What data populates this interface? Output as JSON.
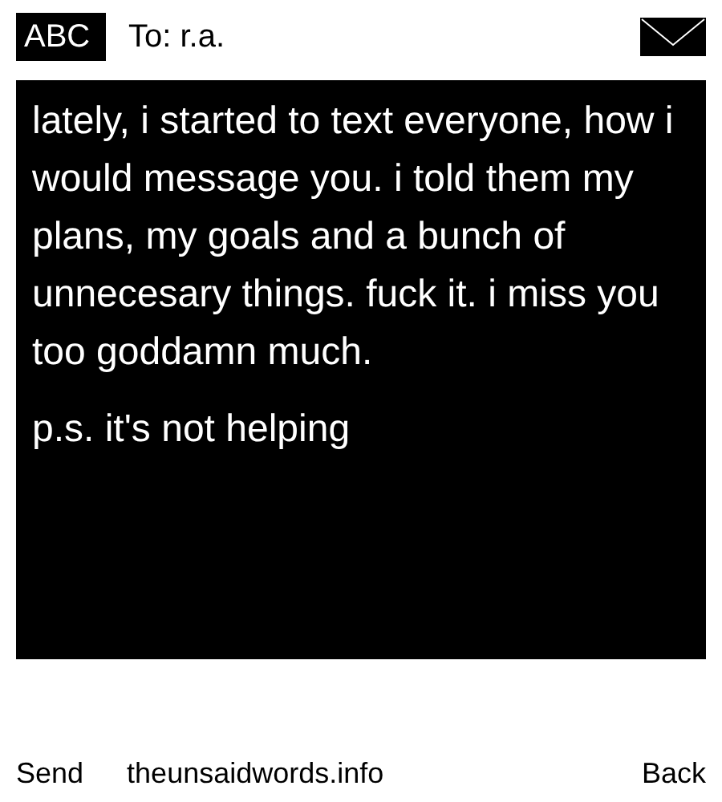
{
  "header": {
    "mode": "ABC",
    "recipient": "To: r.a."
  },
  "message": {
    "paragraphs": [
      "lately, i started to text everyone, how i would message you. i told them my plans, my goals and a bunch of unnecesary things. fuck it. i miss you too goddamn much.",
      "p.s. it's not helping"
    ]
  },
  "footer": {
    "left": "Send",
    "site": "theunsaidwords.info",
    "right": "Back"
  }
}
